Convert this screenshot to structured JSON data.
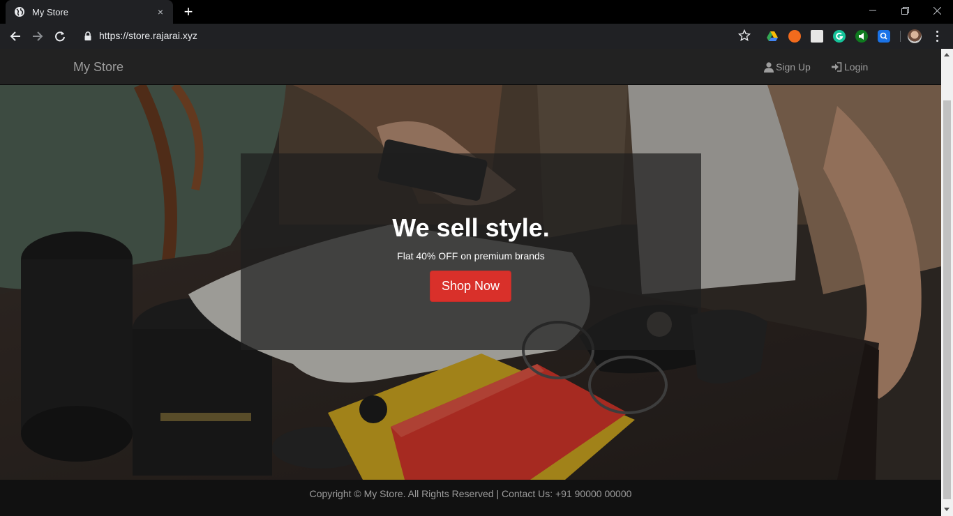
{
  "browser": {
    "tab_title": "My Store",
    "tab_close": "×",
    "new_tab": "+",
    "url": "https://store.rajarai.xyz"
  },
  "navbar": {
    "brand": "My Store",
    "signup_label": "Sign Up",
    "login_label": "Login"
  },
  "banner": {
    "title": "We sell style.",
    "subtitle": "Flat 40% OFF on premium brands",
    "button_label": "Shop Now"
  },
  "footer": {
    "text": "Copyright © My Store. All Rights Reserved | Contact Us: +91 90000 00000"
  },
  "colors": {
    "navbar_bg": "#222222",
    "shop_button": "#d9302a",
    "footer_bg": "#111111",
    "browser_toolbar": "#202124"
  }
}
